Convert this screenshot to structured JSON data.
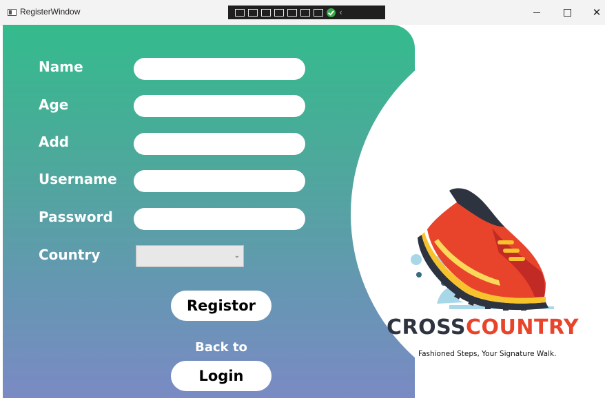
{
  "window": {
    "title": "RegisterWindow",
    "controls": {
      "minimize": "—",
      "maximize": "",
      "close": "✕"
    }
  },
  "form": {
    "name_label": "Name",
    "age_label": "Age",
    "address_label": "Add",
    "username_label": "Username",
    "password_label": "Password",
    "country_label": "Country",
    "name_value": "",
    "age_value": "",
    "address_value": "",
    "username_value": "",
    "password_value": "",
    "country_selected": ""
  },
  "buttons": {
    "register_label": "Registor",
    "back_to_label": "Back to",
    "login_label": "Login"
  },
  "brand": {
    "name_part1": "CROSS",
    "name_part2": "COUNTRY",
    "tagline": "Fashioned Steps, Your Signature Walk."
  },
  "colors": {
    "gradient_top": "#34bb8c",
    "gradient_bottom": "#7a8ac4",
    "brand_dark": "#2d3440",
    "brand_accent": "#e8442b"
  }
}
